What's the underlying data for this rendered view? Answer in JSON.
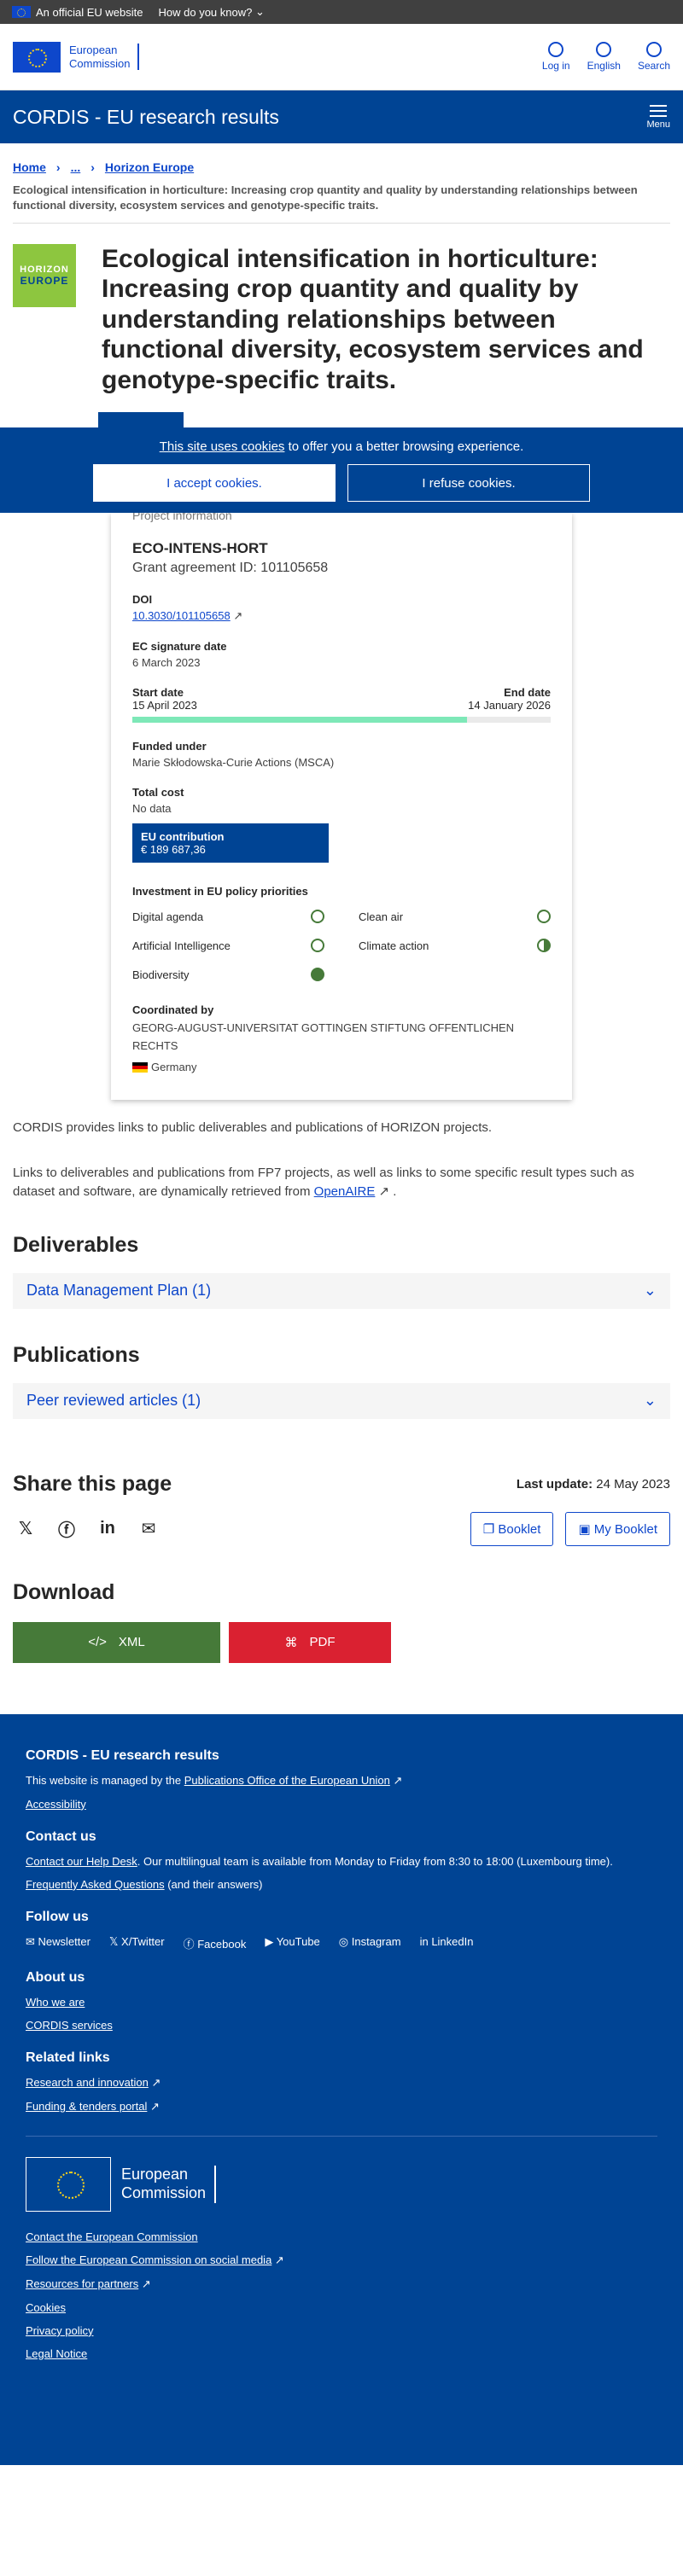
{
  "topbar": {
    "official": "An official EU website",
    "how": "How do you know?"
  },
  "header": {
    "logo_line1": "European",
    "logo_line2": "Commission",
    "login": "Log in",
    "language": "English",
    "search": "Search"
  },
  "sitebar": {
    "title": "CORDIS - EU research results",
    "menu": "Menu"
  },
  "breadcrumb": {
    "home": "Home",
    "ellipsis": "...",
    "current": "Horizon Europe"
  },
  "subtitle": "Ecological intensification in horticulture: Increasing crop quantity and quality by understanding relationships between functional diversity, ecosystem services and genotype-specific traits.",
  "hero": {
    "logo_top": "HORIZON",
    "logo_bottom": "EUROPE",
    "title": "Ecological intensification in horticulture: Increasing crop quantity and quality by understanding relationships between functional diversity, ecosystem services and genotype-specific traits."
  },
  "cookie": {
    "link": "This site uses cookies",
    "msg": " to offer you a better browsing experience.",
    "accept": "I accept cookies.",
    "refuse": "I refuse cookies."
  },
  "project": {
    "panel_title": "Project information",
    "acronym": "ECO-INTENS-HORT",
    "grant": "Grant agreement ID: 101105658",
    "doi_label": "DOI",
    "doi": "10.3030/101105658",
    "sig_label": "EC signature date",
    "sig": "6 March 2023",
    "start_label": "Start date",
    "start": "15 April 2023",
    "end_label": "End date",
    "end": "14 January 2026",
    "progress": 0.8,
    "funded_label": "Funded under",
    "funded": "Marie Skłodowska-Curie Actions (MSCA)",
    "cost_label": "Total cost",
    "cost": "No data",
    "eu_label": "EU contribution",
    "eu_value": "€ 189 687,36",
    "policy_label": "Investment in EU policy priorities",
    "policies": [
      {
        "name": "Digital agenda",
        "level": "none"
      },
      {
        "name": "Clean air",
        "level": "none"
      },
      {
        "name": "Artificial Intelligence",
        "level": "none"
      },
      {
        "name": "Climate action",
        "level": "half"
      },
      {
        "name": "Biodiversity",
        "level": "full"
      }
    ],
    "coord_label": "Coordinated by",
    "coord": "GEORG-AUGUST-UNIVERSITAT GOTTINGEN STIFTUNG OFFENTLICHEN RECHTS",
    "country": "Germany"
  },
  "para1": "CORDIS provides links to public deliverables and publications of HORIZON projects.",
  "para2_a": "Links to deliverables and publications from FP7 projects, as well as links to some specific result types such as dataset and software, are dynamically retrieved from ",
  "para2_link": "OpenAIRE",
  "para2_b": " .",
  "deliverables": {
    "title": "Deliverables",
    "item": "Data Management Plan (1)"
  },
  "publications": {
    "title": "Publications",
    "item": "Peer reviewed articles (1)"
  },
  "share": {
    "title": "Share this page",
    "last_label": "Last update:",
    "last": "24 May 2023",
    "booklet": "Booklet",
    "my_booklet": "My Booklet"
  },
  "download": {
    "title": "Download",
    "xml": "XML",
    "pdf": "PDF"
  },
  "footer": {
    "title": "CORDIS - EU research results",
    "managed_a": "This website is managed by the ",
    "managed_link": "Publications Office of the European Union",
    "accessibility": "Accessibility",
    "contact_h": "Contact us",
    "contact_a": "Contact our Help Desk",
    "contact_b": ". Our multilingual team is available from Monday to Friday from 8:30 to 18:00 (Luxembourg time).",
    "faq": "Frequently Asked Questions",
    "faq_b": " (and their answers)",
    "follow_h": "Follow us",
    "follow": [
      "Newsletter",
      "X/Twitter",
      "Facebook",
      "YouTube",
      "Instagram",
      "LinkedIn"
    ],
    "about_h": "About us",
    "who": "Who we are",
    "services": "CORDIS services",
    "related_h": "Related links",
    "related1": "Research and innovation",
    "related2": "Funding & tenders portal",
    "ec1": "European",
    "ec2": "Commission",
    "links": [
      "Contact the European Commission",
      "Follow the European Commission on social media",
      "Resources for partners",
      "Cookies",
      "Privacy policy",
      "Legal Notice"
    ]
  }
}
